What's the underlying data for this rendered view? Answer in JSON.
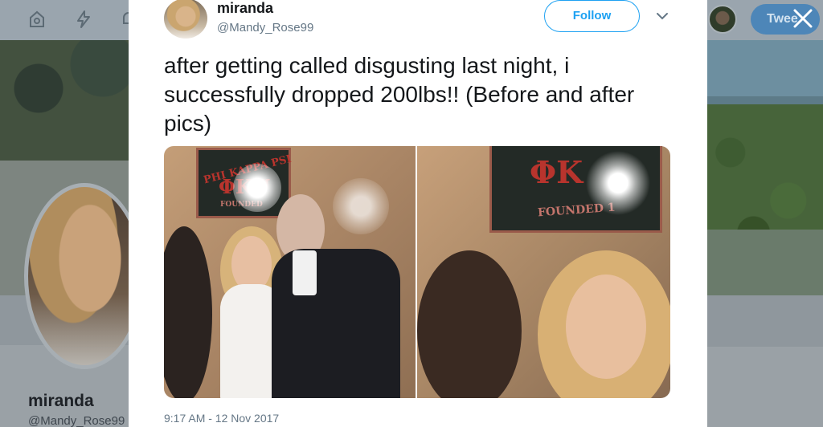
{
  "tweet": {
    "author": {
      "display_name": "miranda",
      "screen_name": "@Mandy_Rose99"
    },
    "text": "after getting called disgusting last night, i successfully dropped 200lbs!! (Before and after pics)",
    "timestamp": "9:17 AM - 12 Nov 2017",
    "follow_label": "Follow"
  },
  "media": {
    "photos": [
      {
        "sign_line1": "PHI KAPPA PSI",
        "sign_line2": "ΦΚΨ",
        "sign_line3": "FOUNDED"
      },
      {
        "sign_line1": "ΦΚ",
        "sign_line2": "FOUNDED 1"
      }
    ]
  },
  "background": {
    "profile_name": "miranda",
    "profile_handle": "@Mandy_Rose99",
    "tweet_button_label": "Twee"
  },
  "colors": {
    "accent": "#1da1f2",
    "text_primary": "#14171a",
    "text_secondary": "#657786"
  },
  "icons": {
    "nav": [
      "home-icon",
      "moments-icon",
      "notifications-icon"
    ],
    "close": "close-icon",
    "caret": "chevron-down-icon"
  }
}
